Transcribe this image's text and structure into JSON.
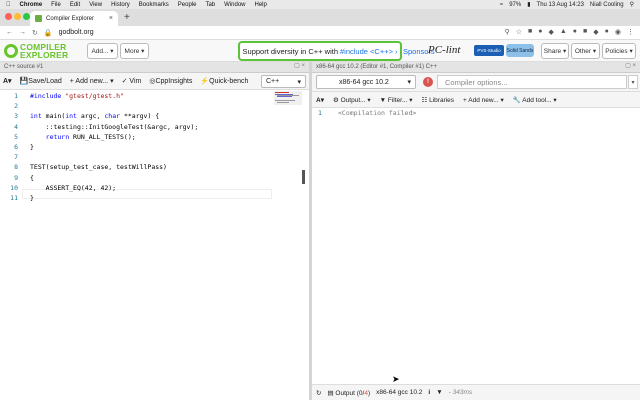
{
  "menubar": {
    "items": [
      "Chrome",
      "File",
      "Edit",
      "View",
      "History",
      "Bookmarks",
      "People",
      "Tab",
      "Window",
      "Help"
    ],
    "battery": "97%",
    "clock": "Thu 13 Aug  14:23",
    "user": "Niall Cooling"
  },
  "browser": {
    "tab_title": "Compiler Explorer",
    "url": "godbolt.org"
  },
  "header": {
    "logo_line1": "COMPILER",
    "logo_line2": "EXPLORER",
    "add_label": "Add...",
    "more_label": "More",
    "banner_text": "Support diversity in C++ with",
    "banner_link": "#include <C++>",
    "banner_arrow": "›",
    "sponsors_label": "Sponsors",
    "pclint_label": "PC-lint",
    "pvs_label": "PVS-Studio",
    "solid_label": "Solid Sands",
    "share_label": "Share",
    "other_label": "Other",
    "policies_label": "Policies"
  },
  "editor": {
    "tab_title": "C++ source #1",
    "toolbar": {
      "save_label": "Save/Load",
      "add_new_label": "+ Add new...",
      "vim_label": "Vim",
      "cppinsights_label": "CppInsights",
      "quickbench_label": "Quick-bench",
      "language": "C++"
    },
    "lines": [
      {
        "n": "1",
        "text": "#include \"gtest/gtest.h\""
      },
      {
        "n": "2",
        "text": ""
      },
      {
        "n": "3",
        "text": "int main(int argc, char **argv) {"
      },
      {
        "n": "4",
        "text": "    ::testing::InitGoogleTest(&argc, argv);"
      },
      {
        "n": "5",
        "text": "    return RUN_ALL_TESTS();"
      },
      {
        "n": "6",
        "text": "}"
      },
      {
        "n": "7",
        "text": ""
      },
      {
        "n": "8",
        "text": "TEST(setup_test_case, testWillPass)"
      },
      {
        "n": "9",
        "text": "{"
      },
      {
        "n": "10",
        "text": "    ASSERT_EQ(42, 42);"
      },
      {
        "n": "11",
        "text": "}"
      }
    ]
  },
  "compiler": {
    "tab_title": "x86-64 gcc 10.2 (Editor #1, Compiler #1) C++",
    "selected": "x86-64 gcc 10.2",
    "options_placeholder": "Compiler options...",
    "toolbar": {
      "output_label": "Output...",
      "filter_label": "Filter...",
      "libraries_label": "Libraries",
      "add_new_label": "+ Add new...",
      "add_tool_label": "Add tool..."
    },
    "asm_line_number": "1",
    "asm_text": "<Compilation failed>",
    "status": {
      "output_label": "Output (",
      "output_count": "0",
      "output_sep": "/",
      "output_errors": "4",
      "output_close": ")",
      "compiler_name": "x86-64 gcc 10.2",
      "time": "- 343ms"
    }
  },
  "colors": {
    "brand_green": "#67c52a",
    "error_red": "#d9534f",
    "link_blue": "#1a73e8"
  }
}
